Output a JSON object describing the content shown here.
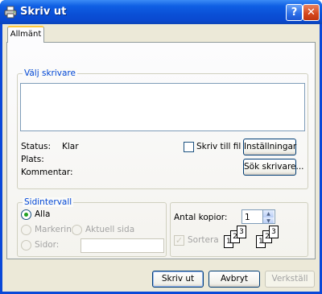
{
  "window": {
    "title": "Skriv ut",
    "help_label": "?",
    "close_label": "✕"
  },
  "tabs": [
    {
      "label": "Allmänt"
    }
  ],
  "printer_group": {
    "legend": "Välj skrivare",
    "status_label": "Status:",
    "status_value": "Klar",
    "location_label": "Plats:",
    "comment_label": "Kommentar:",
    "print_to_file_label": "Skriv till fil",
    "settings_label": "Inställningar",
    "find_printer_label": "Sök skrivare..."
  },
  "page_range": {
    "legend": "Sidintervall",
    "all_label": "Alla",
    "selection_label": "Markering",
    "current_page_label": "Aktuell sida",
    "pages_label": "Sidor:",
    "pages_value": ""
  },
  "copies": {
    "count_label": "Antal kopior:",
    "count_value": "1",
    "collate_label": "Sortera"
  },
  "buttons": {
    "print_label": "Skriv ut",
    "cancel_label": "Avbryt",
    "apply_label": "Verkställ"
  }
}
